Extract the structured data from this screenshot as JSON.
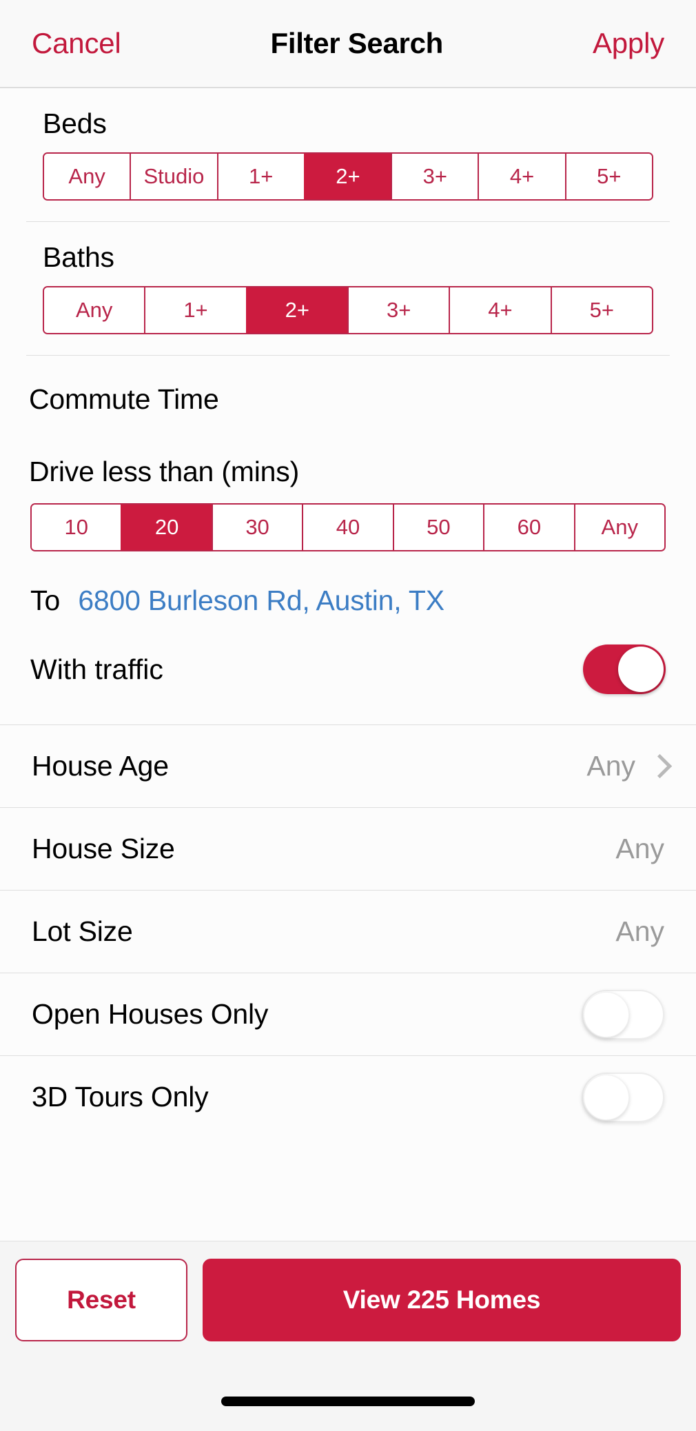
{
  "header": {
    "cancel_label": "Cancel",
    "title": "Filter Search",
    "apply_label": "Apply"
  },
  "beds": {
    "label": "Beds",
    "options": [
      "Any",
      "Studio",
      "1+",
      "2+",
      "3+",
      "4+",
      "5+"
    ],
    "selected": "2+"
  },
  "baths": {
    "label": "Baths",
    "options": [
      "Any",
      "1+",
      "2+",
      "3+",
      "4+",
      "5+"
    ],
    "selected": "2+"
  },
  "commute": {
    "section_label": "Commute Time",
    "drive_label": "Drive less than (mins)",
    "options": [
      "10",
      "20",
      "30",
      "40",
      "50",
      "60",
      "Any"
    ],
    "selected": "20",
    "to_label": "To",
    "to_address": "6800 Burleson Rd, Austin, TX",
    "traffic_label": "With traffic",
    "traffic_on": true
  },
  "rows": [
    {
      "label": "House Age",
      "value": "Any",
      "chevron": true
    },
    {
      "label": "House Size",
      "value": "Any",
      "chevron": false
    },
    {
      "label": "Lot Size",
      "value": "Any",
      "chevron": false
    }
  ],
  "switch_rows": [
    {
      "label": "Open Houses Only",
      "on": false
    },
    {
      "label": "3D Tours Only",
      "on": false
    }
  ],
  "footer": {
    "reset_label": "Reset",
    "view_label": "View 225 Homes"
  },
  "colors": {
    "accent": "#cc1b3f",
    "accent_border": "#b8254a",
    "link": "#3c7dc4",
    "muted": "#9a9a9a"
  }
}
